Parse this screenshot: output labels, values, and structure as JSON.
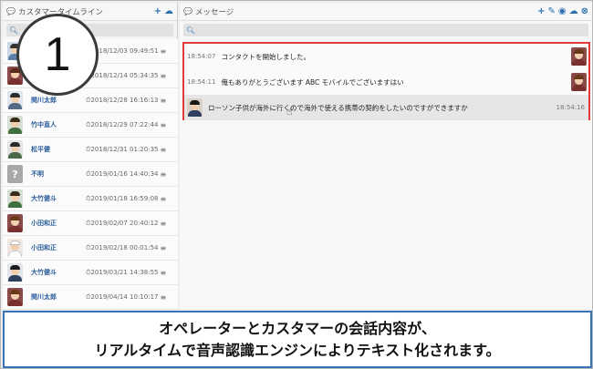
{
  "colors": {
    "accent": "#2a6fb0",
    "highlight_border": "#e03a3a",
    "caption_border": "#3a72b8"
  },
  "left_panel": {
    "title": "カスタマータイムライン",
    "search_placeholder": "",
    "customers": [
      {
        "name": "",
        "time": "2018/12/03 09:49:51",
        "avatar": "hidden"
      },
      {
        "name": "",
        "time": "2018/12/14 05:34:35",
        "avatar": "hidden"
      },
      {
        "name": "関川太郎",
        "time": "2018/12/28 16:16:13",
        "avatar": "man-dark-hair"
      },
      {
        "name": "竹中直人",
        "time": "2018/12/29 07:22:44",
        "avatar": "man-short-hair"
      },
      {
        "name": "松平健",
        "time": "2018/12/31 01:20:35",
        "avatar": "man-short-hair"
      },
      {
        "name": "不明",
        "time": "2019/01/16 14:40:34",
        "avatar": "unknown"
      },
      {
        "name": "大竹健斗",
        "time": "2019/01/18 16:59:08",
        "avatar": "man-short-hair"
      },
      {
        "name": "小田和正",
        "time": "2019/02/07 20:40:12",
        "avatar": "woman-brown-hair"
      },
      {
        "name": "小田和正",
        "time": "2019/02/18 00:01:54",
        "avatar": "chef"
      },
      {
        "name": "大竹健斗",
        "time": "2019/03/21 14:38:55",
        "avatar": "man-dark-hair"
      },
      {
        "name": "関川太郎",
        "time": "2019/04/14 10:10:17",
        "avatar": "woman-brown-hair"
      }
    ]
  },
  "right_panel": {
    "title": "メッセージ",
    "search_placeholder": "",
    "messages": [
      {
        "time": "18:54:07",
        "text": "コンタクトを開始しました。",
        "side": "left"
      },
      {
        "time": "18:54:11",
        "text": "俺もありがとうございます ABC モバイルでございますはい",
        "side": "left"
      },
      {
        "time": "18:54:16",
        "text": "ローソン子供が海外に行くので海外で使える携帯の契約をしたいのですができますか",
        "side": "right"
      }
    ]
  },
  "step_badge": "1",
  "caption": {
    "line1": "オペレーターとカスタマーの会話内容が、",
    "line2": "リアルタイムで音声認識エンジンによりテキスト化されます。"
  }
}
